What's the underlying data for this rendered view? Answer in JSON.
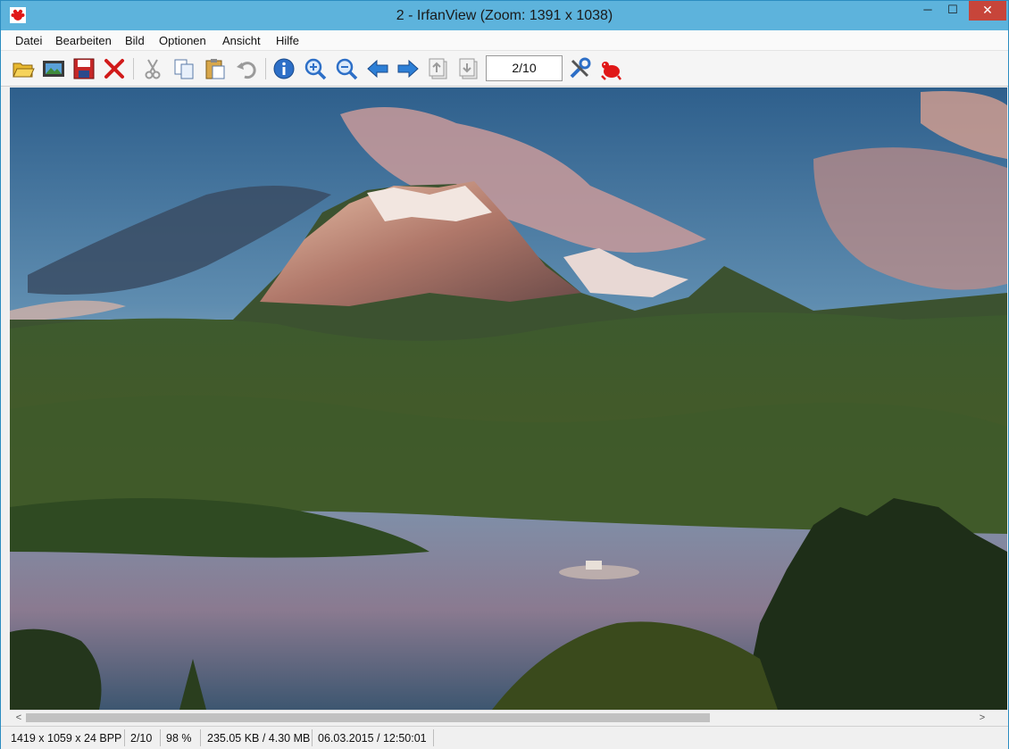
{
  "window": {
    "title": "2  - IrfanView (Zoom: 1391 x 1038)",
    "minimize_glyph": "─",
    "maximize_glyph": "☐",
    "close_glyph": "✕"
  },
  "menu": {
    "items": [
      "Datei",
      "Bearbeiten",
      "Bild",
      "Optionen",
      "Ansicht",
      "Hilfe"
    ]
  },
  "toolbar": {
    "buttons": [
      {
        "name": "open-icon"
      },
      {
        "name": "slideshow-icon"
      },
      {
        "name": "save-icon"
      },
      {
        "name": "delete-icon"
      },
      {
        "name": "cut-icon"
      },
      {
        "name": "copy-icon"
      },
      {
        "name": "paste-icon"
      },
      {
        "name": "undo-icon"
      },
      {
        "name": "info-icon"
      },
      {
        "name": "zoom-in-icon"
      },
      {
        "name": "zoom-out-icon"
      },
      {
        "name": "previous-icon"
      },
      {
        "name": "next-icon"
      },
      {
        "name": "first-page-icon"
      },
      {
        "name": "last-page-icon"
      },
      {
        "name": "settings-icon"
      },
      {
        "name": "irfanview-logo-icon"
      }
    ],
    "page_counter": "2/10"
  },
  "scrollbar": {
    "left_arrow": "<",
    "right_arrow": ">"
  },
  "status": {
    "dimensions": "1419 x 1059 x 24 BPP",
    "page": "2/10",
    "zoom": "98 %",
    "size": "235.05 KB / 4.30 MB",
    "datetime": "06.03.2015 / 12:50:01"
  },
  "colors": {
    "titlebar": "#5db3dc",
    "close_button": "#c7453a"
  }
}
